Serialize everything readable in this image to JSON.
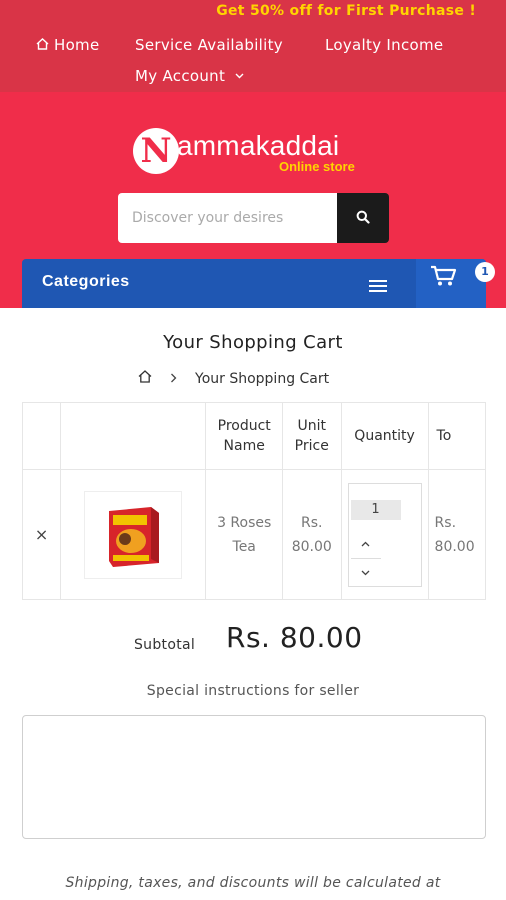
{
  "promo": "Get 50% off for First Purchase !",
  "nav": {
    "home": "Home",
    "service": "Service Availability",
    "loyalty": "Loyalty Income",
    "account": "My Account"
  },
  "logo": {
    "letter": "N",
    "text": "ammakaddai",
    "subtitle": "Online store"
  },
  "search": {
    "placeholder": "Discover your desires"
  },
  "categories": {
    "label": "Categories",
    "cart_count": "1"
  },
  "cart": {
    "title": "Your Shopping Cart",
    "breadcrumb_current": "Your Shopping Cart",
    "columns": [
      "Product Name",
      "Unit Price",
      "Quantity",
      "To"
    ],
    "rows": [
      {
        "remove": "×",
        "product_name": "3 Roses Tea",
        "unit_price": "Rs. 80.00",
        "quantity": "1",
        "total": "Rs. 80.00"
      }
    ]
  },
  "summary": {
    "subtotal_label": "Subtotal",
    "subtotal_value": "Rs. 80.00",
    "instructions_label": "Special instructions for seller",
    "shipping_note": "Shipping, taxes, and discounts will be calculated at"
  },
  "colors": {
    "topbar": "#d93447",
    "header": "#f02d4a",
    "promo": "#ffd400",
    "category_bar": "#1f57b3"
  }
}
